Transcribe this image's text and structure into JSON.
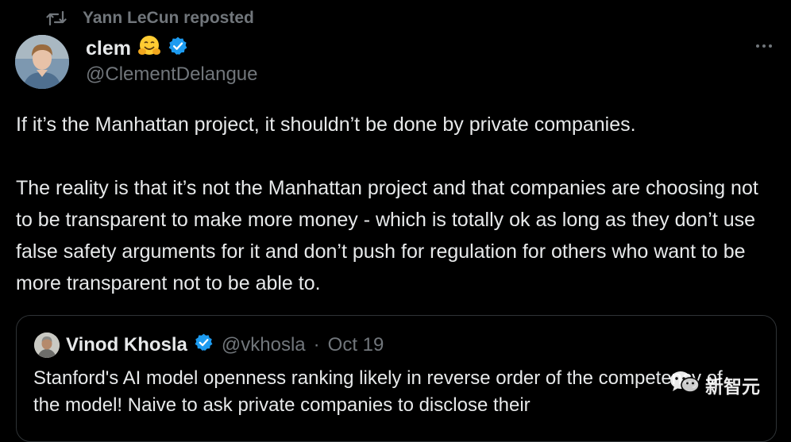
{
  "repost": {
    "label": "Yann LeCun reposted",
    "icon": "repost-icon"
  },
  "tweet": {
    "author_name": "clem",
    "author_emoji": "hugging-face-emoji",
    "handle": "@ClementDelangue",
    "paragraphs": [
      "If it’s the Manhattan project, it shouldn’t be done by private companies.",
      "The reality is that it’s not the Manhattan project and that companies are choosing not to be transparent to make more money - which is totally ok as long as they don’t use false safety arguments for it and don’t push for regulation for others who want to be more transparent not to be able to."
    ]
  },
  "quote": {
    "author_name": "Vinod Khosla",
    "handle": "@vkhosla",
    "separator": "·",
    "date": "Oct 19",
    "text": "Stanford's AI model openness ranking likely in reverse order of the competency of the model! Naive to ask private companies to disclose their"
  },
  "watermark": {
    "text": "新智元"
  },
  "colors": {
    "background": "#000000",
    "text": "#e7e9ea",
    "muted": "#71767b",
    "verified": "#1d9bf0",
    "border": "#2f3336"
  }
}
